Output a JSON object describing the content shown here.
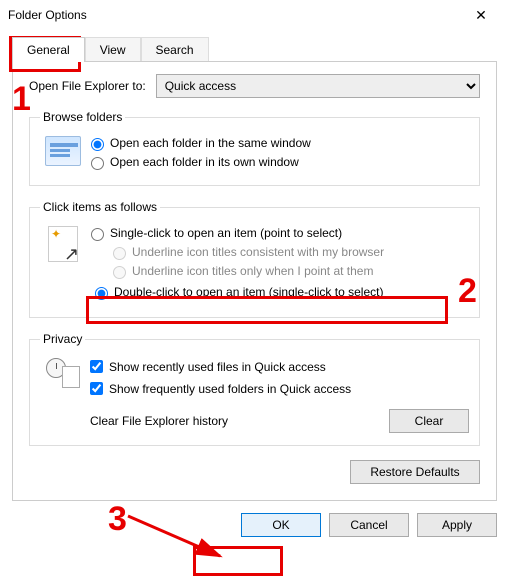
{
  "window": {
    "title": "Folder Options"
  },
  "tabs": {
    "general": "General",
    "view": "View",
    "search": "Search"
  },
  "open": {
    "label": "Open File Explorer to:",
    "selected": "Quick access"
  },
  "browse": {
    "legend": "Browse folders",
    "same": "Open each folder in the same window",
    "own": "Open each folder in its own window"
  },
  "click": {
    "legend": "Click items as follows",
    "single": "Single-click to open an item (point to select)",
    "underline_browser": "Underline icon titles consistent with my browser",
    "underline_point": "Underline icon titles only when I point at them",
    "double": "Double-click to open an item (single-click to select)"
  },
  "privacy": {
    "legend": "Privacy",
    "recent_files": "Show recently used files in Quick access",
    "frequent_folders": "Show frequently used folders in Quick access",
    "clear_label": "Clear File Explorer history",
    "clear_btn": "Clear"
  },
  "restore": "Restore Defaults",
  "footer": {
    "ok": "OK",
    "cancel": "Cancel",
    "apply": "Apply"
  },
  "annotations": {
    "n1": "1",
    "n2": "2",
    "n3": "3"
  }
}
